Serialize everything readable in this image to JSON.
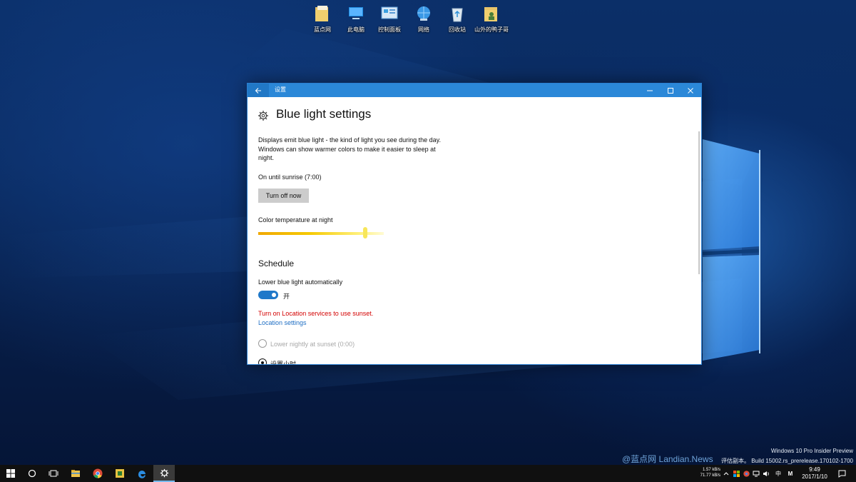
{
  "desktop": {
    "icons": [
      {
        "label": "蓝点网",
        "icon": "folder-icon"
      },
      {
        "label": "此电脑",
        "icon": "computer-icon"
      },
      {
        "label": "控制面板",
        "icon": "control-panel-icon"
      },
      {
        "label": "网络",
        "icon": "network-icon"
      },
      {
        "label": "回收站",
        "icon": "recycle-bin-icon"
      },
      {
        "label": "山外的鸭子哥",
        "icon": "user-folder-icon"
      }
    ]
  },
  "window": {
    "title": "设置",
    "back_icon": "back-arrow-icon",
    "controls": [
      "minimize-icon",
      "maximize-icon",
      "close-icon"
    ]
  },
  "settings": {
    "page_title": "Blue light settings",
    "description_lines": [
      "Displays emit blue light - the kind of light you see during the day.",
      "Windows can show warmer colors to make it easier to sleep at",
      "night."
    ],
    "status": "On until sunrise (7:00)",
    "turn_off_button": "Turn off now",
    "color_temp_label": "Color temperature at night",
    "color_temp_level": 0.85,
    "schedule_heading": "Schedule",
    "auto_label": "Lower blue light automatically",
    "toggle_state": "开",
    "toggle_on": true,
    "location_warning": "Turn on Location services to use sunset.",
    "location_link": "Location settings",
    "radio_options": [
      {
        "label": "Lower nightly at sunset (0:00)",
        "selected": false,
        "disabled": true
      },
      {
        "label": "设置小时",
        "selected": true,
        "disabled": false
      }
    ],
    "colors": {
      "accent": "#2b88d8",
      "warning": "#d30000",
      "link": "#1f6fc4"
    }
  },
  "watermark": {
    "line1": "Windows 10 Pro Insider Preview",
    "line2": "评估副本。 Build 15002.rs_prerelease.170102-1700",
    "logo_text": "@蓝点网 Landian.News"
  },
  "taskbar": {
    "apps": [
      "windows-start-icon",
      "cortana-icon",
      "task-view-icon",
      "file-explorer-icon",
      "chrome-icon",
      "app-icon",
      "edge-icon",
      "settings-icon"
    ],
    "net_up": "1.57 kB/s",
    "net_down": "71.77 kB/s",
    "tray_icons": [
      "chevron-up-icon",
      "windows-flag-icon",
      "chrome-tray-icon",
      "network-tray-icon",
      "volume-icon",
      "ime-zh-icon",
      "m-icon"
    ],
    "ime_label": "中",
    "m_label": "M",
    "time": "9:49",
    "date": "2017/1/10",
    "notification_icon": "action-center-icon"
  }
}
